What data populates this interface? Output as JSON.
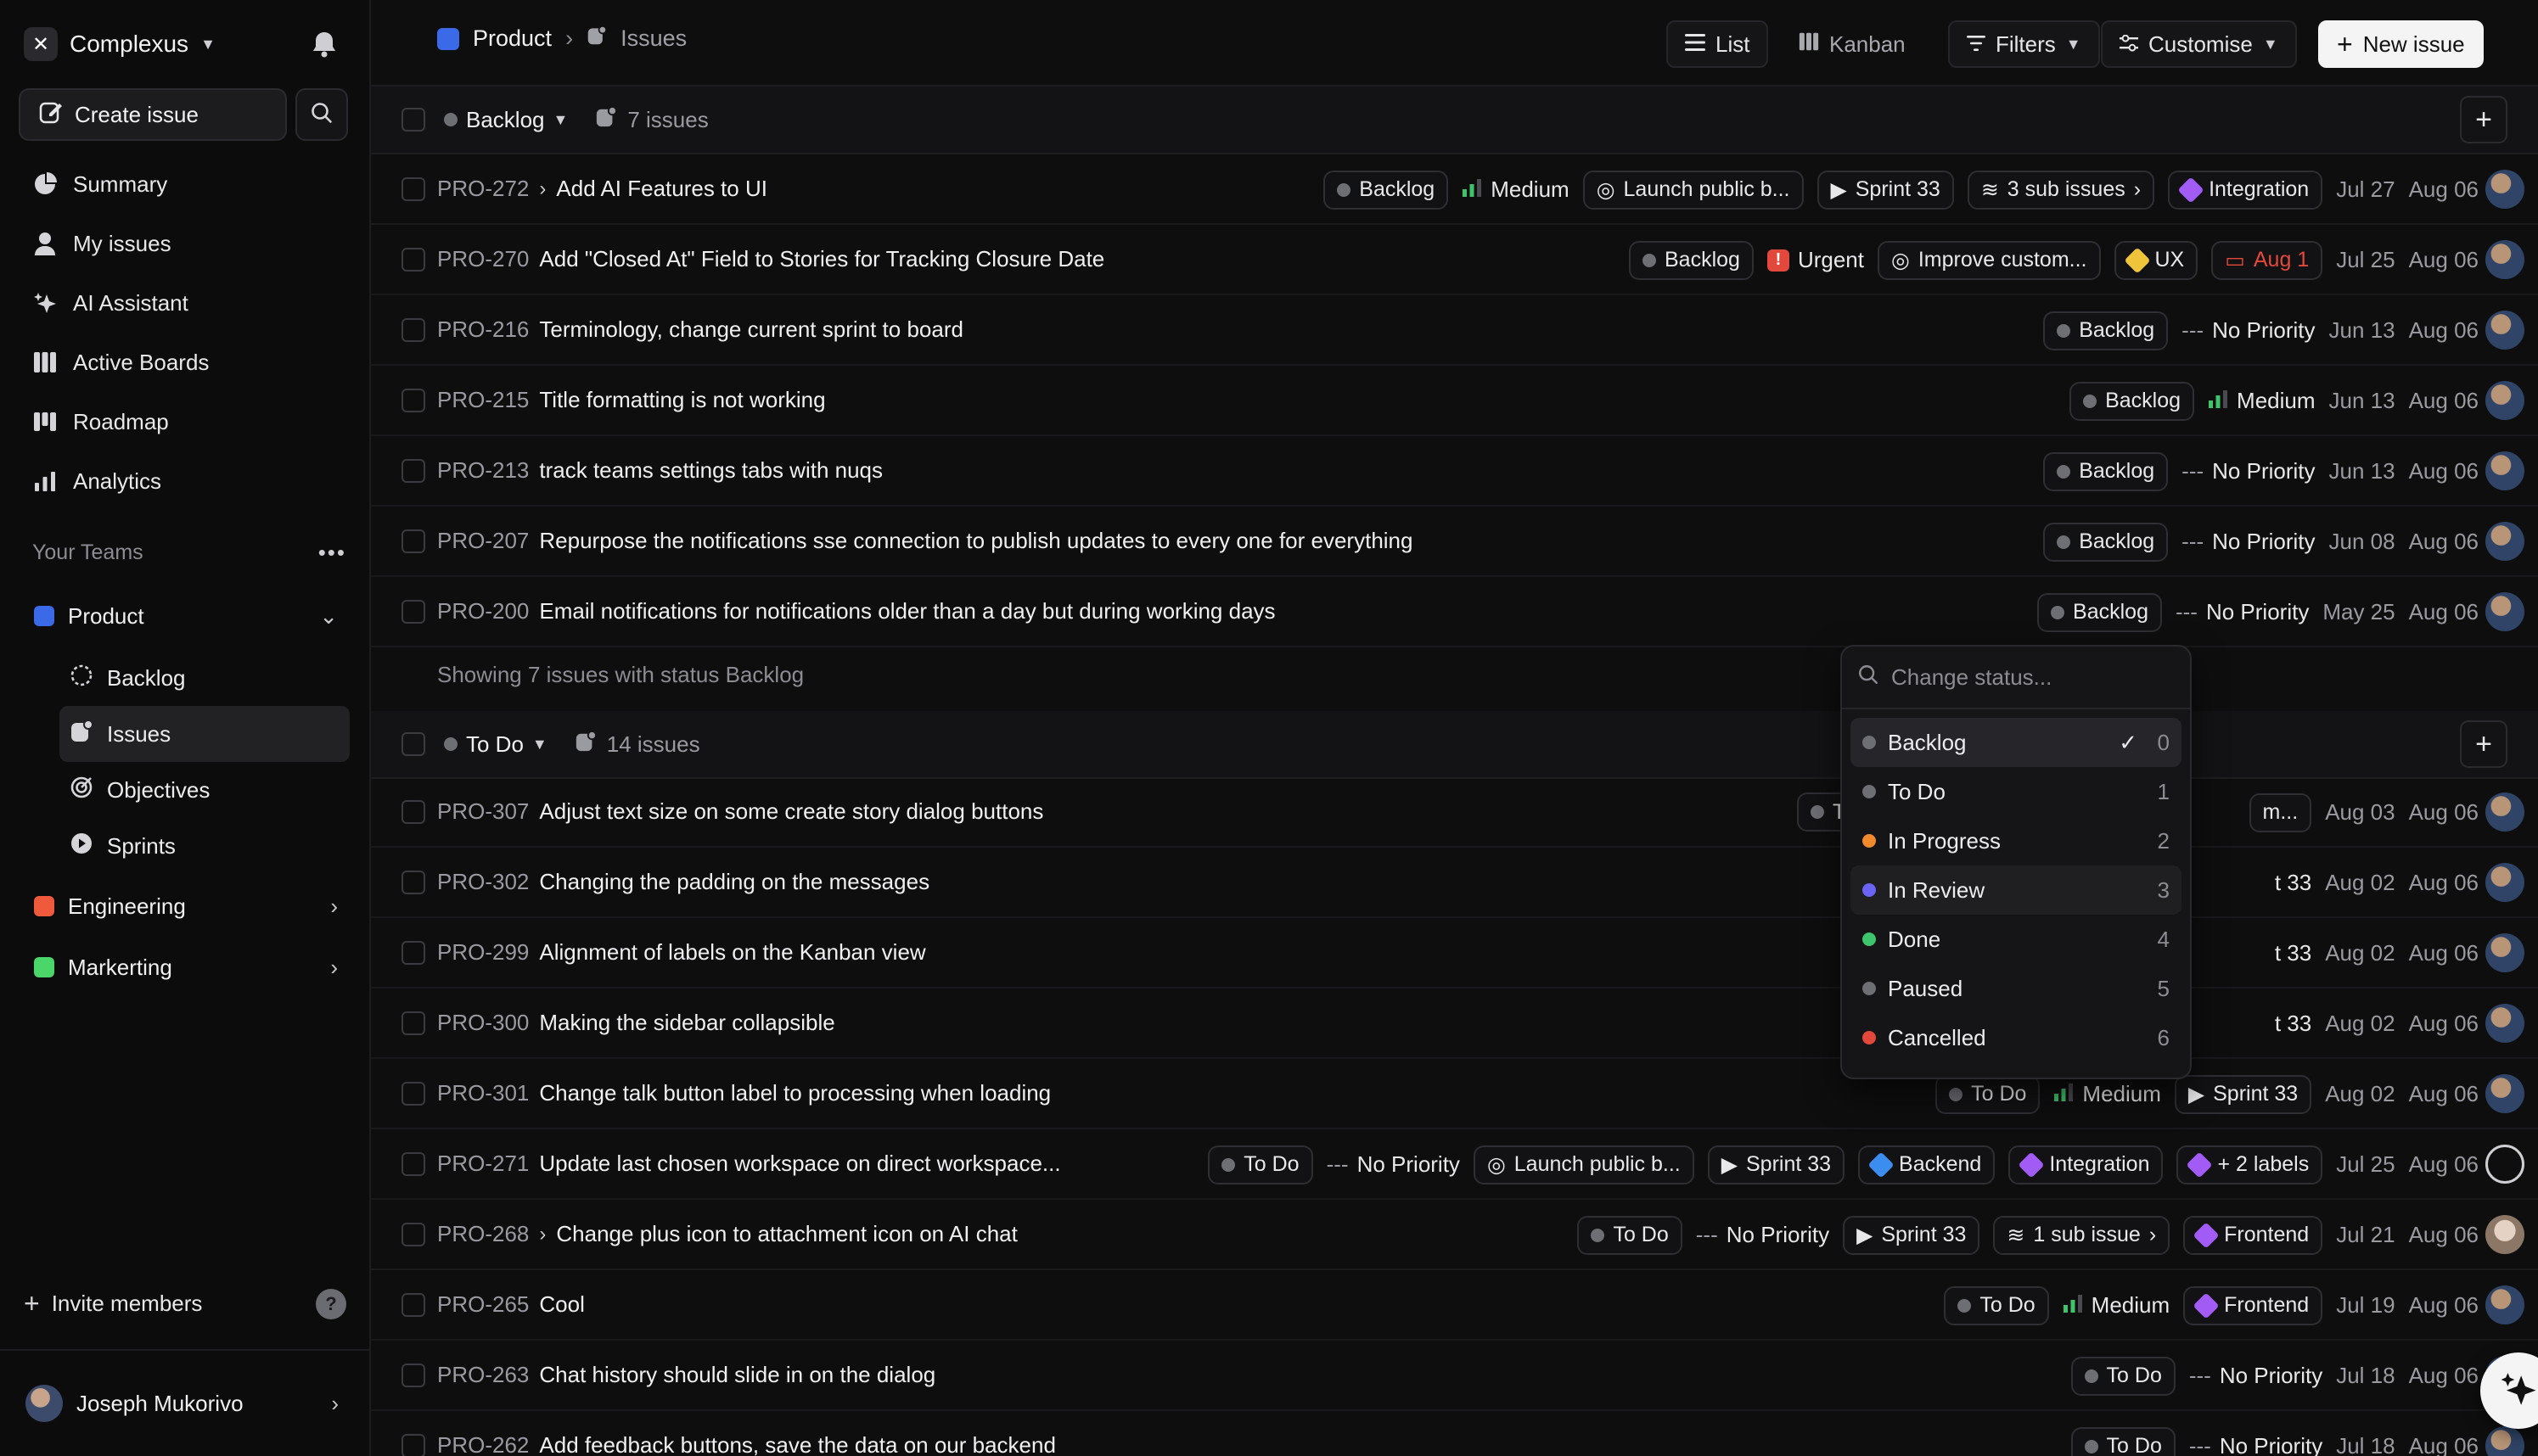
{
  "workspace": {
    "name": "Complexus"
  },
  "sidebar": {
    "create_label": "Create issue",
    "nav": [
      {
        "label": "Summary",
        "icon": "pie-chart-icon"
      },
      {
        "label": "My issues",
        "icon": "user-icon"
      },
      {
        "label": "AI Assistant",
        "icon": "sparkle-icon"
      },
      {
        "label": "Active Boards",
        "icon": "columns-icon"
      },
      {
        "label": "Roadmap",
        "icon": "roadmap-icon"
      },
      {
        "label": "Analytics",
        "icon": "bar-chart-icon"
      }
    ],
    "teams_heading": "Your Teams",
    "teams": [
      {
        "name": "Product",
        "color": "#3b6ae8"
      },
      {
        "name": "Engineering",
        "color": "#f05a3c"
      },
      {
        "name": "Markerting",
        "color": "#4bd66a"
      }
    ],
    "product_sub": [
      "Backlog",
      "Issues",
      "Objectives",
      "Sprints"
    ],
    "invite_label": "Invite members",
    "user_name": "Joseph Mukorivo"
  },
  "header": {
    "breadcrumb_team": "Product",
    "breadcrumb_page": "Issues",
    "view_list": "List",
    "view_kanban": "Kanban",
    "filters": "Filters",
    "customise": "Customise",
    "new_issue": "New issue"
  },
  "groups": {
    "backlog": {
      "status": "Backlog",
      "count": "7 issues",
      "showing": "Showing 7 issues with status Backlog"
    },
    "todo": {
      "status": "To Do",
      "count": "14 issues"
    }
  },
  "backlog_rows": [
    {
      "id": "PRO-272",
      "title": "Add AI Features to UI",
      "status": "Backlog",
      "priority": "Medium",
      "objective": "Launch public b...",
      "sprint": "Sprint 33",
      "sub": "3 sub issues",
      "label": "Integration",
      "start": "Jul 27",
      "end": "Aug 06"
    },
    {
      "id": "PRO-270",
      "title": "Add \"Closed At\" Field to Stories for Tracking Closure Date",
      "status": "Backlog",
      "priority": "Urgent",
      "objective": "Improve custom...",
      "label": "UX",
      "due": "Aug 1",
      "start": "Jul 25",
      "end": "Aug 06"
    },
    {
      "id": "PRO-216",
      "title": "Terminology, change current sprint to board",
      "status": "Backlog",
      "priority": "No Priority",
      "start": "Jun 13",
      "end": "Aug 06"
    },
    {
      "id": "PRO-215",
      "title": "Title formatting is not working",
      "status": "Backlog",
      "priority": "Medium",
      "start": "Jun 13",
      "end": "Aug 06"
    },
    {
      "id": "PRO-213",
      "title": "track teams settings tabs with nuqs",
      "status": "Backlog",
      "priority": "No Priority",
      "start": "Jun 13",
      "end": "Aug 06"
    },
    {
      "id": "PRO-207",
      "title": "Repurpose the notifications sse connection to publish updates to every one for everything",
      "status": "Backlog",
      "priority": "No Priority",
      "start": "Jun 08",
      "end": "Aug 06"
    },
    {
      "id": "PRO-200",
      "title": "Email notifications for notifications older than a day but during working days",
      "status": "Backlog",
      "priority": "No Priority",
      "start": "May 25",
      "end": "Aug 06"
    }
  ],
  "todo_rows": [
    {
      "id": "PRO-307",
      "title": "Adjust text size on some create story dialog buttons",
      "peek_left": "T",
      "peek_right": "m...",
      "start": "Aug 03",
      "end": "Aug 06"
    },
    {
      "id": "PRO-302",
      "title": "Changing the padding on the messages",
      "peek_right": "t 33",
      "start": "Aug 02",
      "end": "Aug 06"
    },
    {
      "id": "PRO-299",
      "title": "Alignment of labels on the Kanban view",
      "peek_right": "t 33",
      "start": "Aug 02",
      "end": "Aug 06"
    },
    {
      "id": "PRO-300",
      "title": "Making the sidebar collapsible",
      "peek_right": "t 33",
      "start": "Aug 02",
      "end": "Aug 06"
    },
    {
      "id": "PRO-301",
      "title": "Change talk button label to processing when loading",
      "status": "To Do",
      "priority": "Medium",
      "sprint": "Sprint 33",
      "start": "Aug 02",
      "end": "Aug 06"
    },
    {
      "id": "PRO-271",
      "title": "Update last chosen workspace on direct workspace...",
      "status": "To Do",
      "priority": "No Priority",
      "objective": "Launch public b...",
      "sprint": "Sprint 33",
      "label1": "Backend",
      "label2": "Integration",
      "more": "+ 2 labels",
      "start": "Jul 25",
      "end": "Aug 06"
    },
    {
      "id": "PRO-268",
      "title": "Change plus icon to attachment icon on AI chat",
      "status": "To Do",
      "priority": "No Priority",
      "sprint": "Sprint 33",
      "sub": "1 sub issue",
      "label": "Frontend",
      "start": "Jul 21",
      "end": "Aug 06"
    },
    {
      "id": "PRO-265",
      "title": "Cool",
      "status": "To Do",
      "priority": "Medium",
      "label": "Frontend",
      "start": "Jul 19",
      "end": "Aug 06"
    },
    {
      "id": "PRO-263",
      "title": "Chat history should slide in on the dialog",
      "status": "To Do",
      "priority": "No Priority",
      "start": "Jul 18",
      "end": "Aug 06"
    },
    {
      "id": "PRO-262",
      "title": "Add feedback buttons, save the data on our backend",
      "status": "To Do",
      "priority": "No Priority",
      "start": "Jul 18",
      "end": "Aug 06"
    }
  ],
  "status_menu": {
    "placeholder": "Change status...",
    "options": [
      {
        "label": "Backlog",
        "color": "#6e6e75",
        "num": "0"
      },
      {
        "label": "To Do",
        "color": "#6e6e75",
        "num": "1"
      },
      {
        "label": "In Progress",
        "color": "#f08a2c",
        "num": "2"
      },
      {
        "label": "In Review",
        "color": "#6a63f5",
        "num": "3"
      },
      {
        "label": "Done",
        "color": "#3ec46a",
        "num": "4"
      },
      {
        "label": "Paused",
        "color": "#6e6e75",
        "num": "5"
      },
      {
        "label": "Cancelled",
        "color": "#e2483b",
        "num": "6"
      }
    ]
  },
  "colors": {
    "label_purple": "#a25cf5",
    "label_blue": "#3b8ef0",
    "label_gold": "#f0c43a",
    "priority_green": "#3ec46a",
    "urgent_red": "#e2483b"
  }
}
